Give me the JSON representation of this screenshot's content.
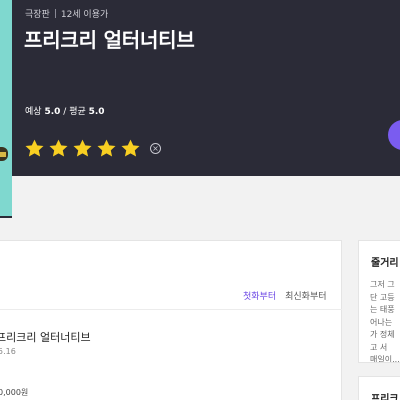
{
  "header": {
    "meta": [
      "극장판",
      "12세 이용가"
    ],
    "title": "프리크리 얼터너티브",
    "rating_expected_label": "예상",
    "rating_expected_value": "5.0",
    "rating_separator": "/",
    "rating_average_label": "평균",
    "rating_average_value": "5.0",
    "user_rating": 5,
    "star_color": "#f8cf22",
    "clear_symbol": "×"
  },
  "episodes": {
    "sort_options": [
      "첫화부터",
      "최신화부터"
    ],
    "active_sort": "첫화부터",
    "accent": "#6b46e5",
    "item": {
      "title": "프리크리 얼터너티브",
      "date_fragment": "5.16",
      "price_fragment": "0,000원"
    }
  },
  "sidebar": {
    "plot": {
      "heading": "줄거리",
      "lines": [
        "그저 그",
        "단 고등",
        "는 태풍",
        "어나는",
        "가 정체",
        "고 서 ",
        "매일이..."
      ]
    },
    "next_heading": "프리크"
  }
}
